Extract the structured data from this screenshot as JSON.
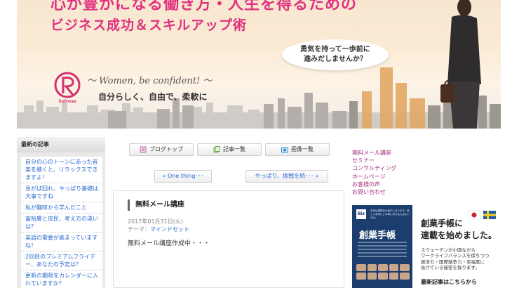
{
  "header": {
    "headline_line1": "心が豊かになる働き方・人生を得るための",
    "headline_line2": "ビジネス成功＆スキルアップ術",
    "bubble_line1": "勇気を持って一歩前に",
    "bubble_line2": "進みだしませんか？",
    "brand": "Solrose",
    "tagline": "～ Women, be confident! ～",
    "subtagline": "自分らしく、自由で、柔軟に",
    "accent_color": "#e0317f"
  },
  "left_sidebar": {
    "heading": "最新の記事",
    "articles": [
      "自分の心のトーンにあった音楽を聴くと、リラックスできますよ！",
      "急がば回れ、やっぱり基礎は大事ですね",
      "私が趣味から学んだこと",
      "富裕層と庶民、考え方の違いは？",
      "英語の需要が高まっていますね！",
      "2回目のプレミアムフライデー、あなたの予定は？",
      "更新の期限をカレンダーに入れていますか？"
    ]
  },
  "tabs": [
    {
      "label": "ブログトップ",
      "icon": "blog-icon"
    },
    {
      "label": "記事一覧",
      "icon": "article-list-icon"
    },
    {
      "label": "画像一覧",
      "icon": "image-list-icon"
    }
  ],
  "nav": {
    "prev": "« One thing･･･",
    "next": "やっぱり、挑戦を続･･･ »"
  },
  "post": {
    "title": "無料メール講座",
    "date": "2017年01月31日(火)",
    "theme_label": "テーマ：",
    "theme_link": "マインドセット",
    "body": "無料メール講座作成中・・・"
  },
  "right_sidebar": {
    "links": [
      "無料メール講座",
      "セミナー",
      "コンサルティング",
      "ホームページ",
      "お客様の声",
      "お問い合わせ"
    ],
    "link_color": "#a5317f",
    "ad": {
      "book_badge": "Biz",
      "book_blurb": "未来は国際化の途中にあります。新しい未来にどの様に向き合えばよいのか。",
      "book_title": "創業手帳",
      "title_line1": "創業手帳に",
      "title_line2": "連載を始めました。",
      "desc_line1": "スウェーデンが小国ながら",
      "desc_line2": "ワークライフバランスを保ちつつ",
      "desc_line3": "経済力・国際競争力・幸福度に",
      "desc_line4": "長けている秘密を探ります。",
      "more": "最新記事はこちらから"
    }
  }
}
